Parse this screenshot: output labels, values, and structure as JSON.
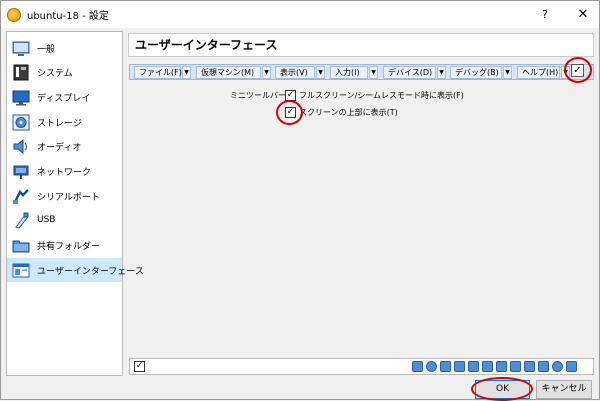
{
  "window": {
    "title": "ubuntu-18 - 設定",
    "help": "?",
    "close": "✕"
  },
  "sidebar": {
    "items": [
      {
        "label": "一般",
        "icon": "general-icon"
      },
      {
        "label": "システム",
        "icon": "system-icon"
      },
      {
        "label": "ディスプレイ",
        "icon": "display-icon"
      },
      {
        "label": "ストレージ",
        "icon": "storage-icon"
      },
      {
        "label": "オーディオ",
        "icon": "audio-icon"
      },
      {
        "label": "ネットワーク",
        "icon": "network-icon"
      },
      {
        "label": "シリアルポート",
        "icon": "serial-port-icon"
      },
      {
        "label": "USB",
        "icon": "usb-icon"
      },
      {
        "label": "共有フォルダー",
        "icon": "shared-folder-icon"
      },
      {
        "label": "ユーザーインターフェース",
        "icon": "user-interface-icon",
        "active": true
      }
    ]
  },
  "main": {
    "title": "ユーザーインターフェース",
    "menus": [
      "ファイル(F)",
      "仮想マシン(M)",
      "表示(V)",
      "入力(I)",
      "デバイス(D)",
      "デバッグ(B)",
      "ヘルプ(H)"
    ],
    "menubar_enabled": "☑",
    "mini_toolbar_label": "ミニツールバー:",
    "mini_toolbar_option1": "フルスクリーン/シームレスモード時に表示(F)",
    "mini_toolbar_option2": "スクリーンの上部に表示(T)",
    "check": "✓",
    "statusbar_enabled": "☑"
  },
  "buttons": {
    "ok": "OK",
    "cancel": "キャンセル"
  },
  "colors": {
    "accent": "#0078d7",
    "highlight": "#cde8ff",
    "annotation": "#d40000"
  }
}
